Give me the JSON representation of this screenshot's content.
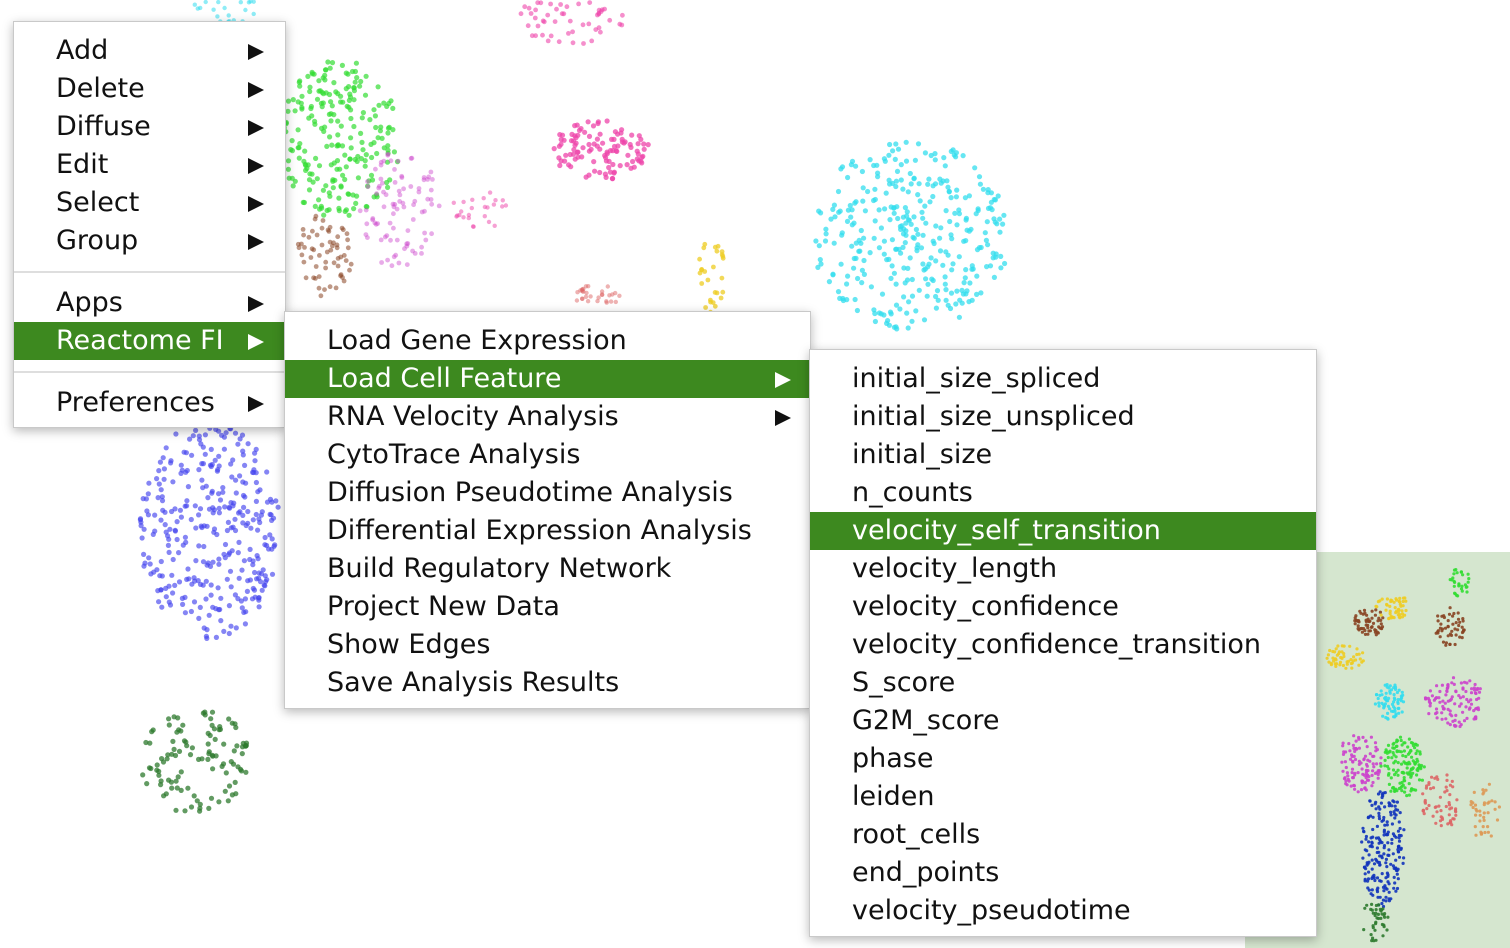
{
  "main_menu": {
    "items_group1": [
      "Add",
      "Delete",
      "Diffuse",
      "Edit",
      "Select",
      "Group"
    ],
    "apps": "Apps",
    "reactome": "Reactome FI",
    "preferences": "Preferences"
  },
  "reactome_menu": {
    "items": [
      "Load Gene Expression",
      "Load Cell Feature",
      "RNA Velocity Analysis",
      "CytoTrace Analysis",
      "Diffusion Pseudotime Analysis",
      "Differential Expression Analysis",
      "Build Regulatory Network",
      "Project New Data",
      "Show Edges",
      "Save Analysis Results"
    ],
    "highlighted_index": 1
  },
  "cell_feature_menu": {
    "items": [
      "initial_size_spliced",
      "initial_size_unspliced",
      "initial_size",
      "n_counts",
      "velocity_self_transition",
      "velocity_length",
      "velocity_confidence",
      "velocity_confidence_transition",
      "S_score",
      "G2M_score",
      "phase",
      "leiden",
      "root_cells",
      "end_points",
      "velocity_pseudotime"
    ],
    "highlighted_index": 4
  },
  "icons": {
    "submenu_arrow": "triangle-right-icon"
  },
  "colors": {
    "highlight": "#3d891f",
    "minimap_background": "#d5e6cf",
    "cluster_colors": [
      "#4444ee",
      "#33dd33",
      "#ee44aa",
      "#33ddee",
      "#eecc22",
      "#884422",
      "#2d7a2d",
      "#cc44cc",
      "#dd6666",
      "#1133bb"
    ]
  }
}
